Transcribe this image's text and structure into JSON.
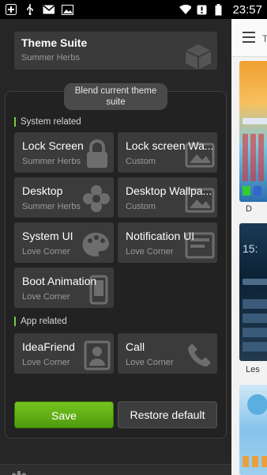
{
  "status_bar": {
    "time": "23:57",
    "icons": [
      "plus-icon",
      "usb-icon",
      "mail-icon",
      "image-icon",
      "wifi-icon",
      "alert-icon",
      "battery-icon"
    ]
  },
  "theme_suite": {
    "title": "Theme Suite",
    "subtitle": "Summer Herbs"
  },
  "blend_button": {
    "label": "Blend current theme suite"
  },
  "sections": {
    "system": "System related",
    "app": "App related"
  },
  "tiles": {
    "lock_screen": {
      "title": "Lock Screen",
      "subtitle": "Summer Herbs",
      "icon": "lock-icon"
    },
    "lock_screen_wallpaper": {
      "title": "Lock screen Wa...",
      "subtitle": "Custom",
      "icon": "picture-icon"
    },
    "desktop": {
      "title": "Desktop",
      "subtitle": "Summer Herbs",
      "icon": "flower-icon"
    },
    "desktop_wallpaper": {
      "title": "Desktop Wallpa...",
      "subtitle": "Custom",
      "icon": "picture-icon"
    },
    "system_ui": {
      "title": "System UI",
      "subtitle": "Love Corner",
      "icon": "palette-icon"
    },
    "notification_ui": {
      "title": "Notification UI",
      "subtitle": "Love Corner",
      "icon": "notification-icon"
    },
    "boot_animation": {
      "title": "Boot Animation",
      "subtitle": "Love Corner",
      "icon": "phone-icon"
    },
    "ideafriend": {
      "title": "IdeaFriend",
      "subtitle": "Love Corner",
      "icon": "contact-icon"
    },
    "call": {
      "title": "Call",
      "subtitle": "Love Corner",
      "icon": "phone-call-icon"
    }
  },
  "buttons": {
    "save": "Save",
    "restore": "Restore default"
  },
  "side_panel": {
    "arrow": "T",
    "thumb1_label": "D",
    "thumb2_time": "15:",
    "thumb2_label": "Les"
  },
  "colors": {
    "accent_green": "#74c41f",
    "section_marker": "#7ac943"
  }
}
